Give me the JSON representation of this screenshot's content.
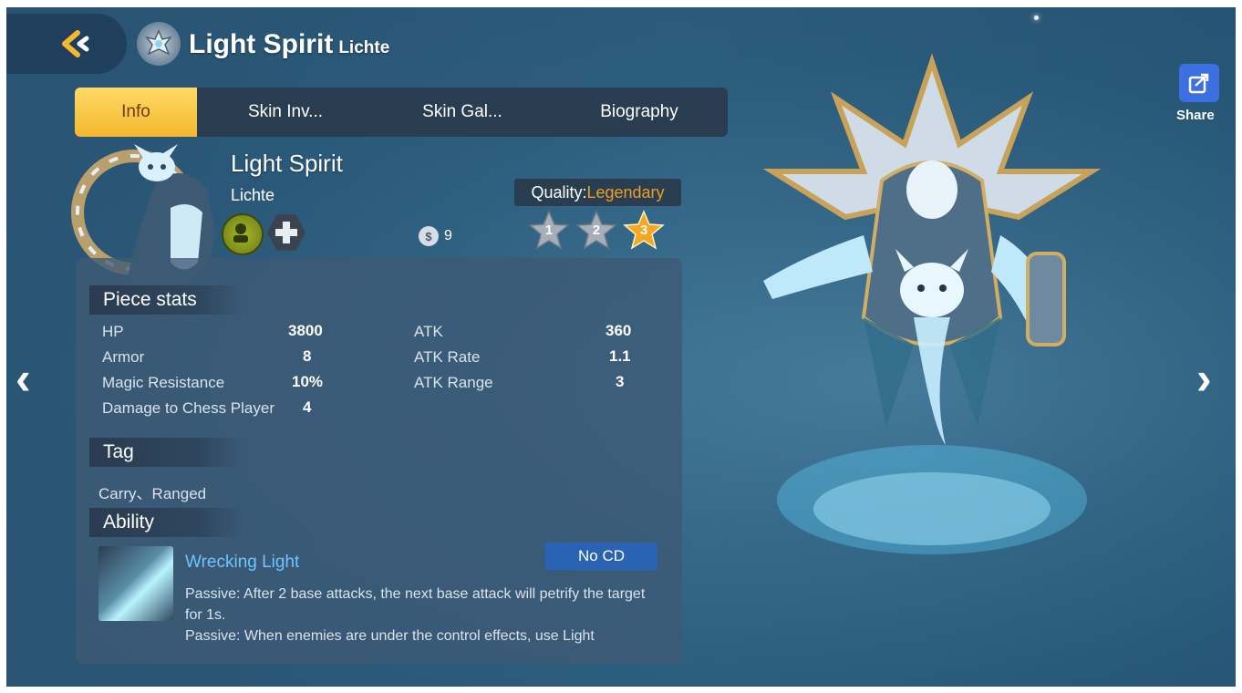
{
  "header": {
    "title": "Light Spirit",
    "title_sub": "Lichte"
  },
  "tabs": [
    {
      "label": "Info",
      "active": true
    },
    {
      "label": "Skin Inv...",
      "active": false
    },
    {
      "label": "Skin Gal...",
      "active": false
    },
    {
      "label": "Biography",
      "active": false
    }
  ],
  "piece": {
    "name": "Light Spirit",
    "subname": "Lichte",
    "cost": "9",
    "quality_label": "Quality:",
    "quality_value": "Legendary",
    "stars": [
      "1",
      "2",
      "3"
    ],
    "current_star": 3
  },
  "stats": {
    "heading": "Piece stats",
    "left": [
      {
        "label": "HP",
        "value": "3800"
      },
      {
        "label": "Armor",
        "value": "8"
      },
      {
        "label": "Magic Resistance",
        "value": "10%"
      },
      {
        "label": "Damage to Chess Player",
        "value": "4"
      }
    ],
    "right": [
      {
        "label": "ATK",
        "value": "360"
      },
      {
        "label": "ATK Rate",
        "value": "1.1"
      },
      {
        "label": "ATK Range",
        "value": "3"
      }
    ]
  },
  "tag": {
    "heading": "Tag",
    "text": "Carry、Ranged"
  },
  "ability": {
    "heading": "Ability",
    "name": "Wrecking Light",
    "cd": "No CD",
    "desc_line1": "Passive: After 2 base attacks, the next base attack will petrify the target for 1s.",
    "desc_line2": "Passive: When enemies are under the control effects, use Light"
  },
  "share": {
    "label": "Share"
  },
  "nav": {
    "prev": "‹",
    "next": "›"
  },
  "colors": {
    "active_tab": "#f3b92e",
    "legendary": "#f39c1f",
    "ability_name": "#6fc3ff",
    "cd_badge": "#2a63b3",
    "share_button": "#3c6fe0"
  }
}
